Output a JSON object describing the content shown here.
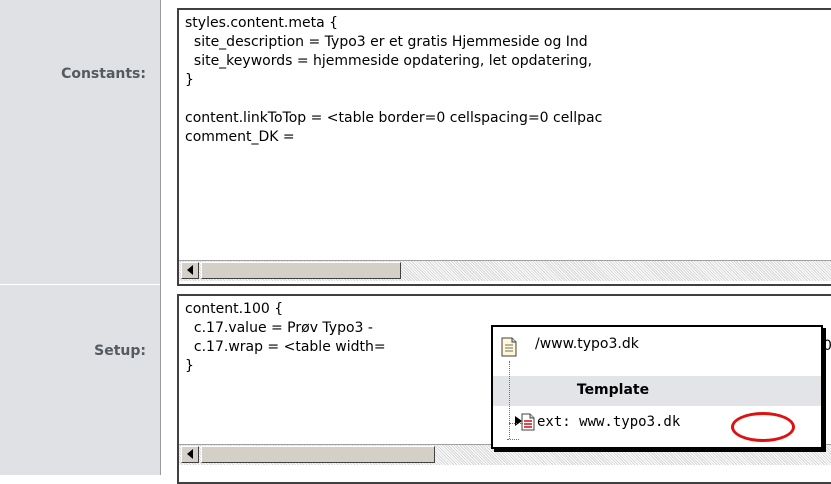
{
  "labels": {
    "constants": "Constants:",
    "setup": "Setup:"
  },
  "constants_editor": {
    "lines": [
      "styles.content.meta {",
      "  site_description = Typo3 er et gratis Hjemmeside og Ind",
      "  site_keywords = hjemmeside opdatering, let opdatering,",
      "}",
      "",
      "content.linkToTop = <table border=0 cellspacing=0 cellpac",
      "comment_DK ="
    ]
  },
  "setup_editor": {
    "lines": [
      "content.100 {",
      "  c.17.value = Prøv Typo3 -",
      "  c.17.wrap = <table width=",
      "}"
    ],
    "peek_char": "0"
  },
  "popup": {
    "title": "/www.typo3.dk",
    "header": "Template",
    "item": "ext: www.typo3.dk"
  },
  "colors": {
    "label_panel": "#dfe1e4",
    "annotation": "#e01010"
  },
  "icons": {
    "page": "page-icon",
    "ext_page": "ext-page-icon",
    "arrow": "tree-arrow-icon",
    "scroll_left": "scroll-left-arrow-icon"
  }
}
